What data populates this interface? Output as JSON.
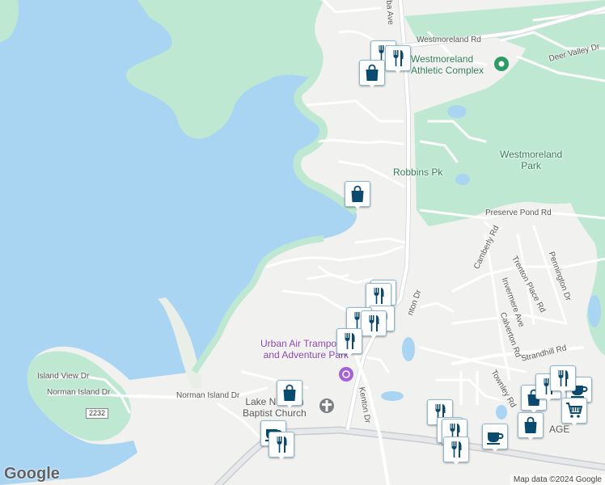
{
  "map": {
    "colors": {
      "water": "#a9d4f2",
      "land": "#f1f1ef",
      "park": "#bfe8d2",
      "road_minor": "#ffffff",
      "road_major": "#aeb4b9",
      "road_casing": "#dadce0",
      "marker_icon": "#0b4a6f",
      "marker_border": "#8fb7d3"
    },
    "labels": {
      "westmoreland_rd": "Westmoreland Rd",
      "westmoreland_athletic": "Westmoreland\nAthletic Complex",
      "deer_valley_dr": "Deer Valley Dr",
      "westmoreland_park": "Westmoreland\nPark",
      "robbins_pk": "Robbins Pk",
      "preserve_pond_rd": "Preserve Pond Rd",
      "camberly_rd": "Camberly Rd",
      "trenton_place_rd": "Trenton Place Rd",
      "pennington_dr": "Pennington Dr",
      "invermere_ave": "Invermere Ave",
      "calverton_rd": "Calverton Rd",
      "strandhill_rd": "Strandhill Rd",
      "townley_rd": "Townley Rd",
      "urban_air": "Urban Air Trampoline\nand Adventure Park",
      "island_view_dr": "Island View Dr",
      "norman_island_dr_w": "Norman Island Dr",
      "norman_island_dr_e": "Norman Island Dr",
      "lake_norman_baptist": "Lake Norman\nBaptist Church",
      "kenton_dr": "Kenton Dr",
      "fenton_dr": "nton Dr",
      "cuba_ave": "ba Ave",
      "age_label": "AGE",
      "route_2232": "2232"
    },
    "logo": "Google",
    "attribution": "Map data ©2024 Google"
  },
  "markers": [
    {
      "type": "restaurant"
    },
    {
      "type": "restaurant"
    },
    {
      "type": "shopping"
    },
    {
      "type": "shopping"
    },
    {
      "type": "restaurant"
    },
    {
      "type": "restaurant"
    },
    {
      "type": "restaurant"
    },
    {
      "type": "restaurant"
    },
    {
      "type": "restaurant"
    },
    {
      "type": "restaurant"
    },
    {
      "type": "restaurant"
    },
    {
      "type": "shopping"
    },
    {
      "type": "cafe"
    },
    {
      "type": "restaurant"
    },
    {
      "type": "restaurant"
    },
    {
      "type": "restaurant"
    },
    {
      "type": "restaurant"
    },
    {
      "type": "cafe"
    },
    {
      "type": "shopping"
    },
    {
      "type": "shopping"
    },
    {
      "type": "cafe"
    },
    {
      "type": "cart"
    },
    {
      "type": "restaurant"
    },
    {
      "type": "restaurant"
    }
  ]
}
